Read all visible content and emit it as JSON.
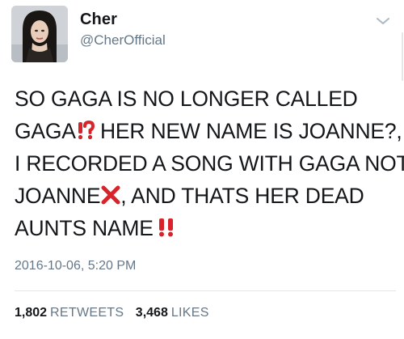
{
  "author": {
    "display_name": "Cher",
    "handle": "@CherOfficial",
    "avatar_icon": "profile-photo"
  },
  "header": {
    "menu_icon": "chevron-down-icon"
  },
  "tweet": {
    "lines": [
      "SO GAGA IS NO LONGER CALLED",
      "GAGA",
      " HER NEW NAME IS JOANNE?,",
      "I RECORDED A SONG WITH GAGA NOT",
      "JOANNE",
      ", AND THATS HER DEAD",
      "AUNTS NAME"
    ],
    "emojis": {
      "interrobang": "interrobang-emoji",
      "cross": "cross-mark-emoji",
      "double_exclamation": "double-exclamation-emoji"
    },
    "emoji_color": "#d8232a",
    "timestamp": "2016-10-06, 5:20 PM"
  },
  "stats": {
    "retweets_count": "1,802",
    "retweets_label": "RETWEETS",
    "likes_count": "3,468",
    "likes_label": "LIKES"
  },
  "colors": {
    "text": "#14171a",
    "secondary": "#657786",
    "divider": "#e1e8ed"
  }
}
